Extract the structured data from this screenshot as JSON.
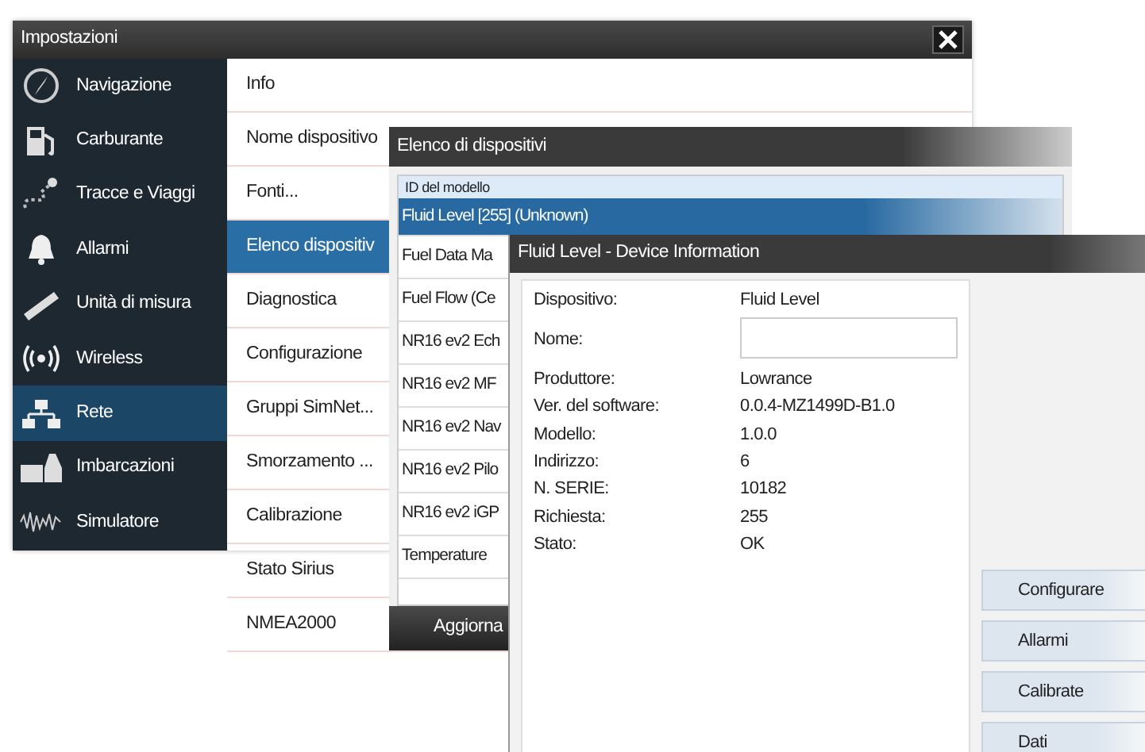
{
  "settings": {
    "title": "Impostazioni",
    "sidebar": [
      {
        "label": "Navigazione",
        "selected": false
      },
      {
        "label": "Carburante",
        "selected": false
      },
      {
        "label": "Tracce e Viaggi",
        "selected": false
      },
      {
        "label": "Allarmi",
        "selected": false
      },
      {
        "label": "Unità di misura",
        "selected": false
      },
      {
        "label": "Wireless",
        "selected": false
      },
      {
        "label": "Rete",
        "selected": true
      },
      {
        "label": "Imbarcazioni",
        "selected": false
      },
      {
        "label": "Simulatore",
        "selected": false
      }
    ],
    "menu": [
      {
        "label": "Info",
        "selected": false
      },
      {
        "label": "Nome dispositivo",
        "selected": false
      },
      {
        "label": "Fonti...",
        "selected": false
      },
      {
        "label": "Elenco dispositiv",
        "selected": true
      },
      {
        "label": "Diagnostica",
        "selected": false
      },
      {
        "label": "Configurazione",
        "selected": false
      },
      {
        "label": "Gruppi SimNet...",
        "selected": false
      },
      {
        "label": "Smorzamento ...",
        "selected": false
      },
      {
        "label": "Calibrazione",
        "selected": false
      },
      {
        "label": "Stato Sirius",
        "selected": false
      },
      {
        "label": "NMEA2000",
        "selected": false
      }
    ]
  },
  "device_list": {
    "title": "Elenco di dispositivi",
    "column": "ID del modello",
    "rows": [
      {
        "label": "Fluid Level [255] (Unknown)",
        "selected": true
      },
      {
        "label": "Fuel Data Ma",
        "selected": false
      },
      {
        "label": "Fuel Flow (Ce",
        "selected": false
      },
      {
        "label": "NR16 ev2 Ech",
        "selected": false
      },
      {
        "label": "NR16 ev2 MF",
        "selected": false
      },
      {
        "label": "NR16 ev2 Nav",
        "selected": false
      },
      {
        "label": "NR16 ev2 Pilo",
        "selected": false
      },
      {
        "label": "NR16 ev2 iGP",
        "selected": false
      },
      {
        "label": "Temperature",
        "selected": false
      }
    ],
    "button": "Aggiorna"
  },
  "device_info": {
    "title": "Fluid Level - Device Information",
    "fields": [
      {
        "label": "Dispositivo:",
        "value": "Fluid Level",
        "kind": "text"
      },
      {
        "label": "Nome:",
        "kind": "input"
      },
      {
        "label": "Produttore:",
        "value": "Lowrance",
        "kind": "text"
      },
      {
        "label": "Ver. del software:",
        "value": "0.0.4-MZ1499D-B1.0",
        "kind": "text"
      },
      {
        "label": "Modello:",
        "value": "1.0.0",
        "kind": "text"
      },
      {
        "label": "Indirizzo:",
        "value": "6",
        "kind": "text"
      },
      {
        "label": "N. SERIE:",
        "value": "10182",
        "kind": "text"
      },
      {
        "label": "Richiesta:",
        "value": "255",
        "kind": "text"
      },
      {
        "label": "Stato:",
        "value": "OK",
        "kind": "text"
      }
    ],
    "buttons": [
      "Configurare",
      "Allarmi",
      "Calibrate",
      "Dati"
    ]
  }
}
